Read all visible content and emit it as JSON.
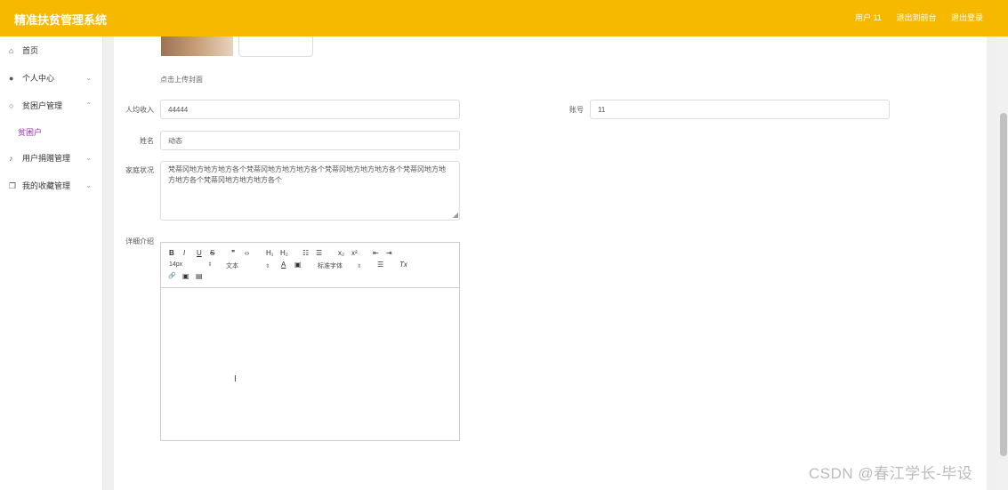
{
  "header": {
    "title": "精准扶贫管理系统",
    "links": [
      "用户 11",
      "退出到前台",
      "退出登录"
    ]
  },
  "sidebar": {
    "items": [
      {
        "label": "首页",
        "icon": "home-icon"
      },
      {
        "label": "个人中心",
        "icon": "user-icon"
      },
      {
        "label": "贫困户管理",
        "icon": "user-outline-icon"
      },
      {
        "label": "用户捐赠管理",
        "icon": "mic-icon"
      },
      {
        "label": "我的收藏管理",
        "icon": "copy-icon"
      }
    ],
    "subitem": "贫困户"
  },
  "form": {
    "upload_hint": "点击上传封面",
    "income_label": "人均收入",
    "income_value": "44444",
    "account_label": "账号",
    "account_value": "11",
    "name_label": "姓名",
    "name_value": "动态",
    "family_label": "家庭状况",
    "family_value": "梵蒂冈地方地方地方各个梵蒂冈地方地方地方各个梵蒂冈地方地方地方各个梵蒂冈地方地方地方各个梵蒂冈地方地方地方各个",
    "detail_label": "详细介绍"
  },
  "editor": {
    "row1": [
      "B",
      "I",
      "U",
      "S",
      "❞",
      "‹›",
      "H₁",
      "H₂",
      "☷",
      "☰",
      "x₂",
      "x²",
      "⇤",
      "⇥"
    ],
    "font_size": "14px",
    "text_type": "文本",
    "font_color": "A",
    "font_bg": "▣",
    "font_family": "标准字体",
    "align": "☰",
    "clear": "Tx",
    "row3": [
      "🔗",
      "▣",
      "▤"
    ]
  },
  "watermark": "CSDN @春江学长-毕设"
}
